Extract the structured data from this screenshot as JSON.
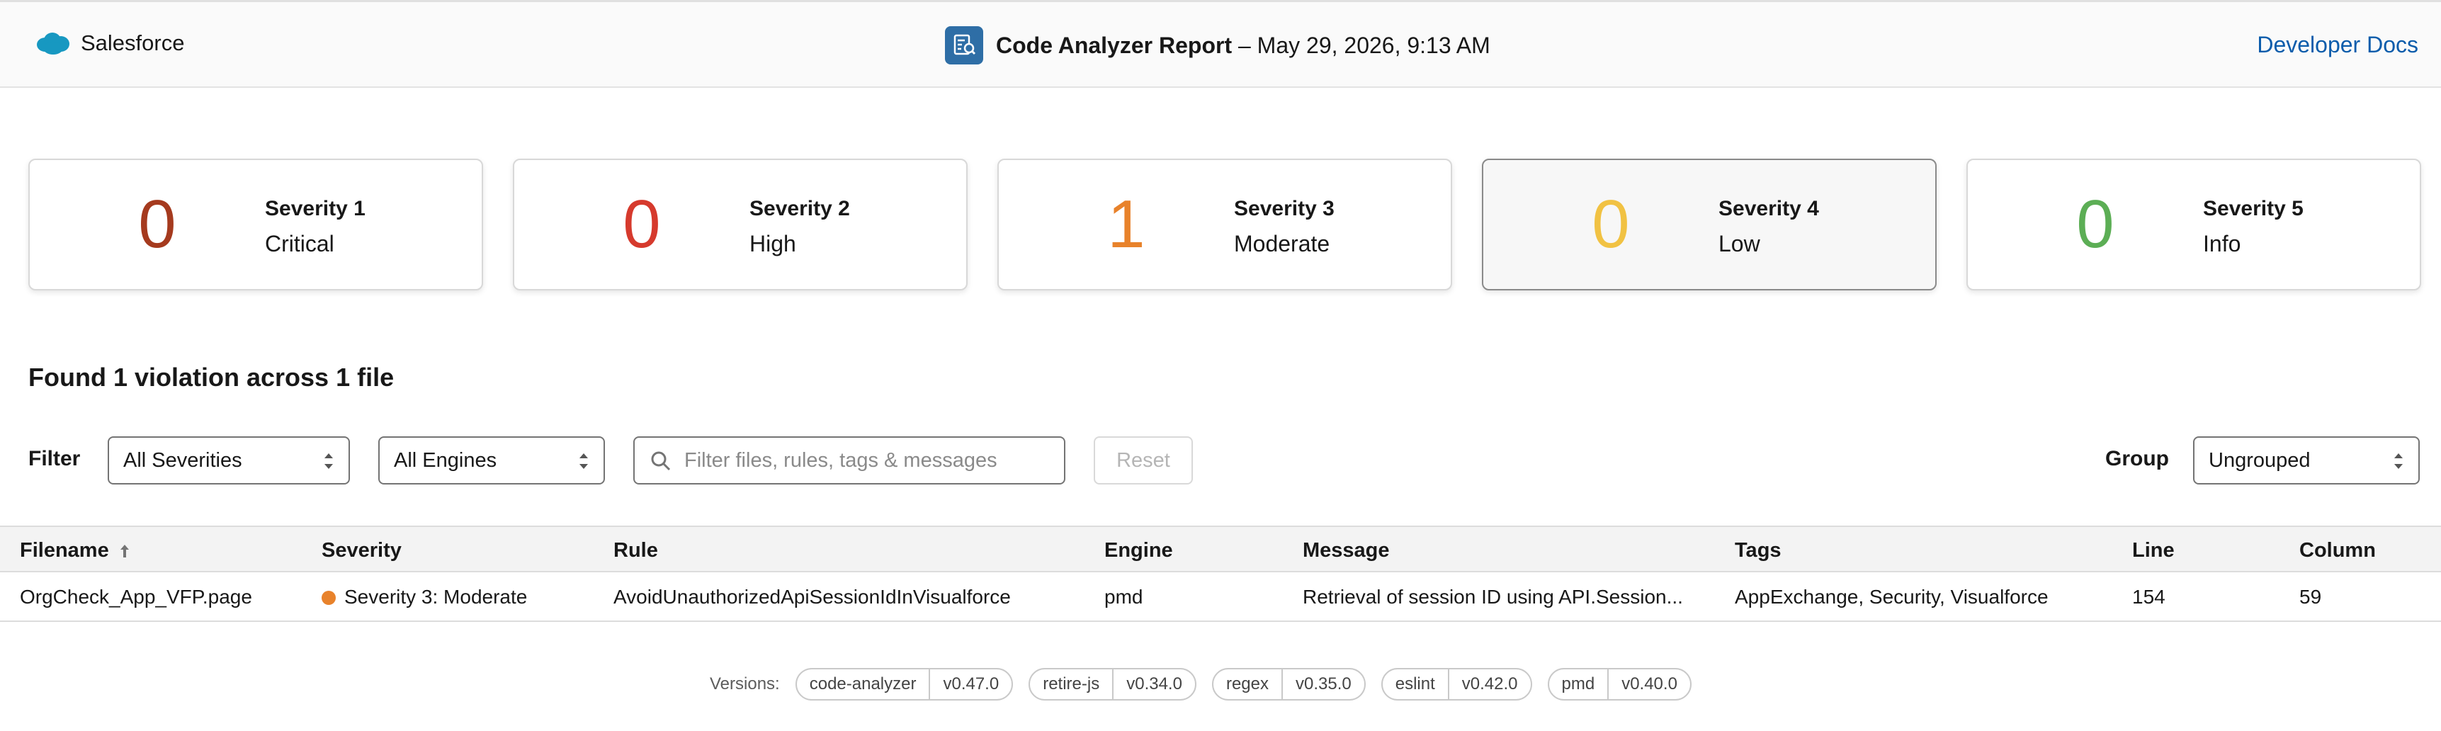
{
  "header": {
    "brand": "Salesforce",
    "title": "Code Analyzer Report",
    "datetime": "– May 29, 2026, 9:13 AM",
    "docs_link": "Developer Docs"
  },
  "colors": {
    "brand_blue": "#2e6ea6",
    "link_blue": "#0b5cab",
    "sev1": "#a53a1e",
    "sev2": "#d63a2d",
    "sev3": "#e8822b",
    "sev4": "#f1c243",
    "sev5": "#5cae55"
  },
  "severity_cards": [
    {
      "count": "0",
      "label": "Severity 1",
      "name": "Critical",
      "color": "#a53a1e"
    },
    {
      "count": "0",
      "label": "Severity 2",
      "name": "High",
      "color": "#d63a2d"
    },
    {
      "count": "1",
      "label": "Severity 3",
      "name": "Moderate",
      "color": "#e8822b"
    },
    {
      "count": "0",
      "label": "Severity 4",
      "name": "Low",
      "color": "#f1c243",
      "selected": true
    },
    {
      "count": "0",
      "label": "Severity 5",
      "name": "Info",
      "color": "#5cae55"
    }
  ],
  "summary": "Found 1 violation across 1 file",
  "filter": {
    "label": "Filter",
    "severity_select": "All Severities",
    "engine_select": "All Engines",
    "search_placeholder": "Filter files, rules, tags & messages",
    "reset": "Reset",
    "group_label": "Group",
    "group_select": "Ungrouped"
  },
  "table": {
    "headers": [
      "Filename",
      "Severity",
      "Rule",
      "Engine",
      "Message",
      "Tags",
      "Line",
      "Column"
    ],
    "rows": [
      {
        "filename": "OrgCheck_App_VFP.page",
        "severity": "Severity 3: Moderate",
        "rule": "AvoidUnauthorizedApiSessionIdInVisualforce",
        "engine": "pmd",
        "message": "Retrieval of session ID using API.Session...",
        "tags": "AppExchange, Security, Visualforce",
        "line": "154",
        "column": "59"
      }
    ]
  },
  "versions": {
    "label": "Versions:",
    "items": [
      {
        "name": "code-analyzer",
        "version": "v0.47.0"
      },
      {
        "name": "retire-js",
        "version": "v0.34.0"
      },
      {
        "name": "regex",
        "version": "v0.35.0"
      },
      {
        "name": "eslint",
        "version": "v0.42.0"
      },
      {
        "name": "pmd",
        "version": "v0.40.0"
      }
    ]
  }
}
